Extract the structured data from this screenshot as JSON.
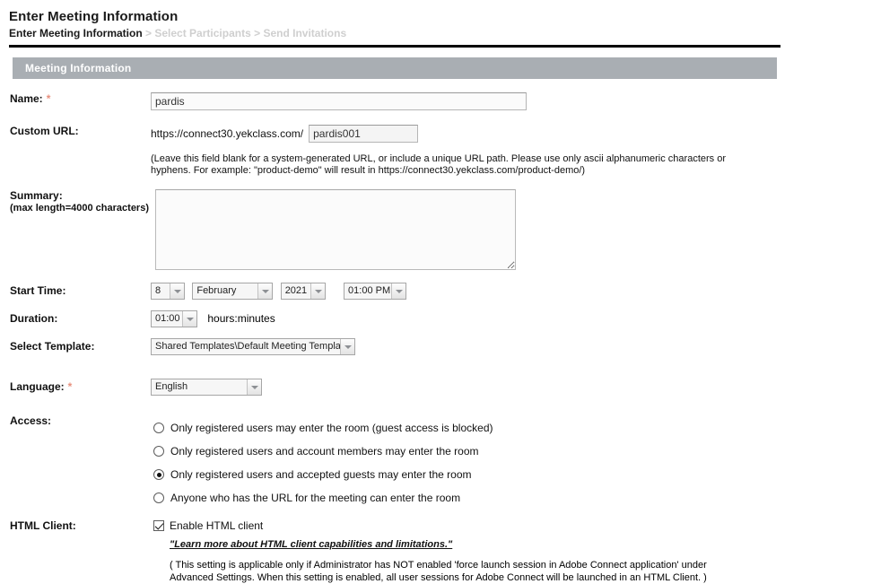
{
  "header": {
    "title": "Enter Meeting Information",
    "breadcrumb": {
      "current": "Enter Meeting Information",
      "sep1": " > ",
      "step2": "Select Participants",
      "sep2": " > ",
      "step3": "Send Invitations"
    }
  },
  "panel": {
    "header_title": "Meeting Information"
  },
  "fields": {
    "name": {
      "label": "Name:",
      "required_mark": "*",
      "value": "pardis",
      "placeholder": ""
    },
    "custom_url": {
      "label": "Custom URL:",
      "prefix": "https://connect30.yekclass.com/",
      "value": "pardis001",
      "placeholder": "",
      "help": "(Leave this field blank for a system-generated URL, or include a unique URL path. Please use only ascii alphanumeric characters or hyphens. For example: \"product-demo\" will result in https://connect30.yekclass.com/product-demo/)"
    },
    "summary": {
      "label": "Summary:",
      "sub_label": "(max length=4000 characters)",
      "value": "",
      "placeholder": ""
    },
    "start_time": {
      "label": "Start Time:",
      "day": "8",
      "month": "February",
      "year": "2021",
      "time": "01:00 PM"
    },
    "duration": {
      "label": "Duration:",
      "value": "01:00",
      "unit_note": "hours:minutes"
    },
    "template": {
      "label": "Select Template:",
      "value": "Shared Templates\\Default Meeting Template"
    },
    "language": {
      "label": "Language:",
      "required_mark": "*",
      "value": "English"
    },
    "access": {
      "label": "Access:",
      "options": [
        {
          "text": "Only registered users may enter the room (guest access is blocked)",
          "selected": false
        },
        {
          "text": "Only registered users and account members may enter the room",
          "selected": false
        },
        {
          "text": "Only registered users and accepted guests may enter the room",
          "selected": true
        },
        {
          "text": "Anyone who has the URL for the meeting can enter the room",
          "selected": false
        }
      ]
    },
    "html_client": {
      "label": "HTML Client:",
      "checkbox_label": "Enable HTML client",
      "checked": true,
      "link_text": "\"Learn more about HTML client capabilities and limitations.\"",
      "note": "( This setting is applicable only if Administrator has NOT enabled 'force launch session in Adobe Connect application' under Advanced Settings. When this setting is enabled, all user sessions for Adobe Connect will be launched in an HTML Client. )"
    }
  },
  "colors": {
    "panel_header_bg": "#a9aeb3",
    "required_asterisk": "#e8907e",
    "breadcrumb_inactive": "#cfcfcf",
    "rule": "#000000"
  }
}
